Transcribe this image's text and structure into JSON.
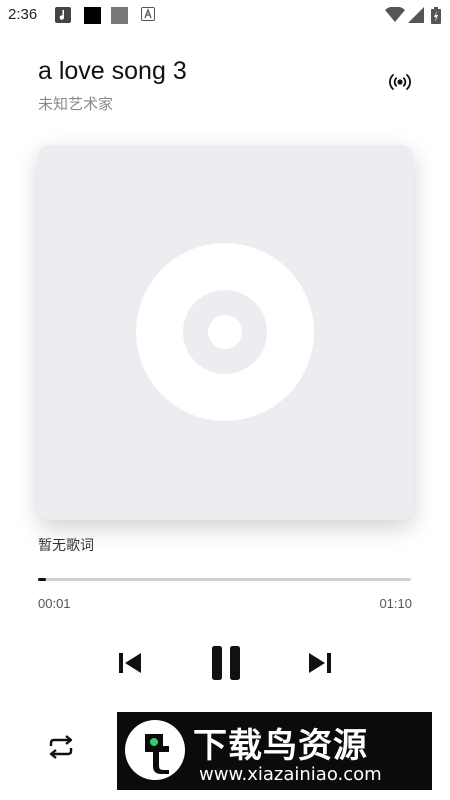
{
  "status_bar": {
    "time": "2:36",
    "notification_icons": [
      "music-note-app-icon",
      "black-square-app-icon",
      "gray-square-app-icon",
      "font-a-app-icon"
    ],
    "system_icons": [
      "wifi-icon",
      "signal-icon",
      "battery-icon"
    ]
  },
  "player": {
    "title": "a love song 3",
    "artist": "未知艺术家",
    "cast_icon": "cast-broadcast-icon",
    "album_placeholder_icon": "disc-icon",
    "lyrics": "暂无歌词",
    "progress": {
      "elapsed": "00:01",
      "total": "01:10",
      "fraction": 0.02
    },
    "controls": {
      "previous_icon": "skip-previous-icon",
      "play_pause_icon": "pause-icon",
      "next_icon": "skip-next-icon",
      "repeat_icon": "repeat-icon"
    }
  },
  "watermark": {
    "title": "下载鸟资源",
    "url": "www.xiazainiao.com"
  },
  "colors": {
    "album_bg": "#ececf1",
    "disc": "#ffffff",
    "progress_track": "#cfcfd4",
    "progress_fill": "#111111"
  }
}
